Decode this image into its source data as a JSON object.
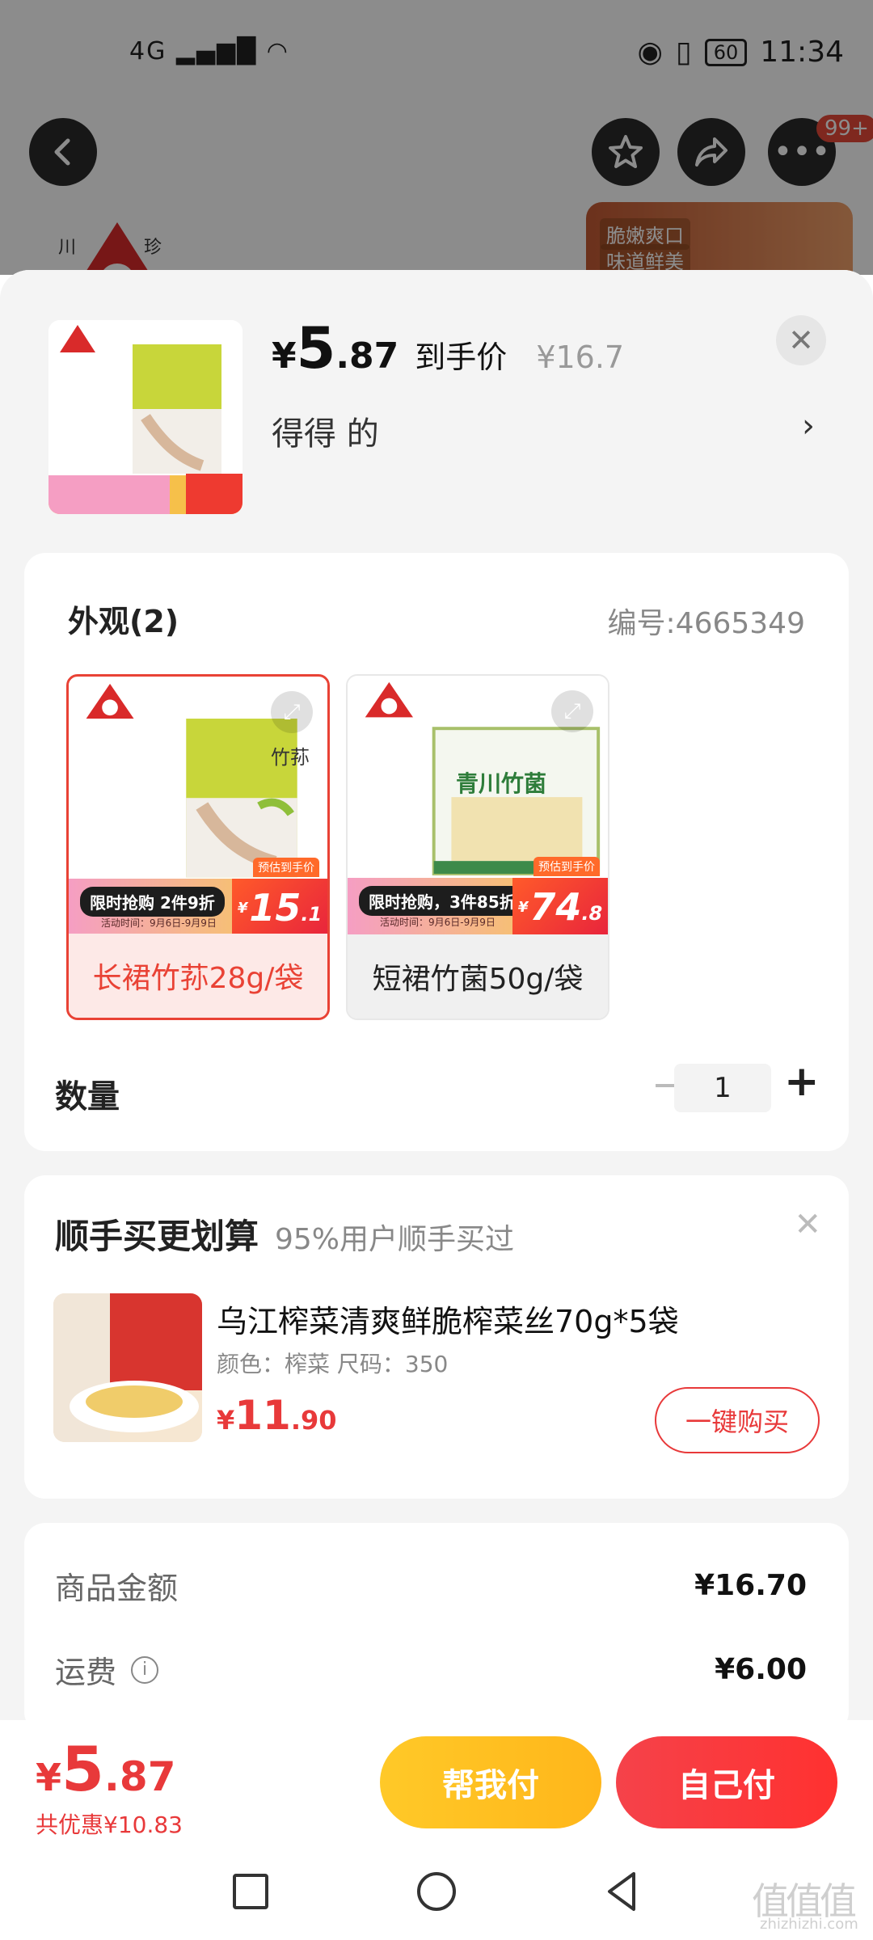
{
  "status_bar": {
    "network": "4G",
    "battery": "60",
    "time": "11:34"
  },
  "header": {
    "more_badge": "99+"
  },
  "background": {
    "brand_left": "川",
    "brand_right": "珍",
    "tags": [
      "脆嫩爽口",
      "味道鲜美"
    ]
  },
  "sheet": {
    "price": {
      "currency": "¥",
      "integer": "5",
      "decimal": ".87",
      "label": "到手价",
      "original": "¥16.7"
    },
    "address": "得得  的",
    "spec": {
      "title": "外观(2)",
      "code": "编号:4665349",
      "options": [
        {
          "label": "长裙竹荪28g/袋",
          "selected": true,
          "promo_pill": "限时抢购 2件9折",
          "promo_date": "活动时间：9月6日-9月9日",
          "promo_caption": "预估到手价",
          "promo_price_int": "15",
          "promo_price_dec": ".1",
          "pack_text": "竹荪"
        },
        {
          "label": "短裙竹菌50g/袋",
          "selected": false,
          "promo_pill": "限时抢购，3件85折",
          "promo_date": "活动时间：9月6日-9月9日",
          "promo_caption": "预估到手价",
          "promo_price_int": "74",
          "promo_price_dec": ".8",
          "pack_text": "青川竹菌"
        }
      ],
      "quantity_label": "数量",
      "quantity": "1"
    },
    "addon": {
      "title": "顺手买更划算",
      "subtitle": "95%用户顺手买过",
      "item_name": "乌江榨菜清爽鲜脆榨菜丝70g*5袋",
      "item_attrs": "颜色：榨菜   尺码：350",
      "price_int": "11",
      "price_dec": ".90",
      "buy_button": "一键购买"
    },
    "summary": [
      {
        "label": "商品金额",
        "value": "¥16.70",
        "info": false
      },
      {
        "label": "运费",
        "value": "¥6.00",
        "info": true
      }
    ]
  },
  "bottom_bar": {
    "total_currency": "¥",
    "total_int": "5",
    "total_dec": ".87",
    "saved": "共优惠¥10.83",
    "help_pay": "帮我付",
    "self_pay": "自己付"
  },
  "watermark": {
    "text": "值值值",
    "url": "zhizhizhi.com"
  },
  "colors": {
    "accent_red": "#e8393a",
    "accent_yellow": "#ffc928",
    "selected_border": "#e94235"
  }
}
